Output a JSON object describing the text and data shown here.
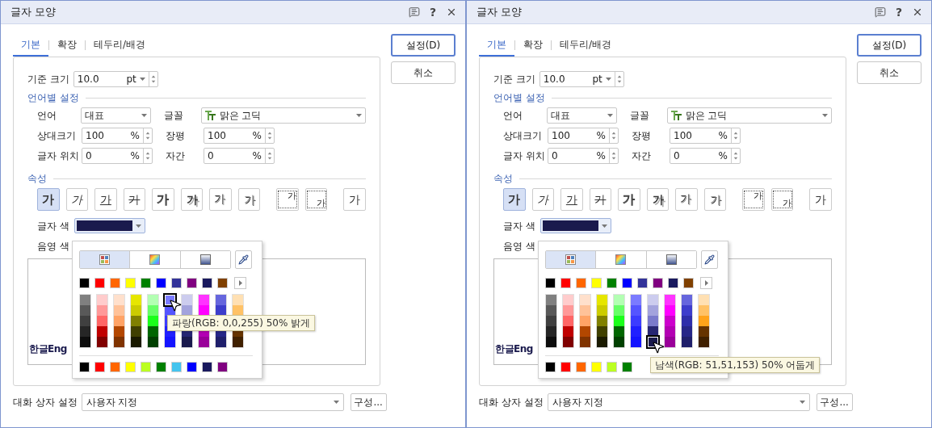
{
  "dialogs": [
    {
      "title": "글자 모양",
      "help": "?",
      "tabs": [
        {
          "label": "기본",
          "selected": true
        },
        {
          "label": "확장",
          "selected": false
        },
        {
          "label": "테두리/배경",
          "selected": false
        }
      ],
      "buttons": [
        {
          "label": "설정(D)",
          "default": true
        },
        {
          "label": "취소",
          "default": false
        }
      ],
      "base_size": {
        "label": "기준 크기",
        "value": "10.0",
        "unit": "pt"
      },
      "language_section": "언어별 설정",
      "language": {
        "label": "언어",
        "value": "대표"
      },
      "font": {
        "label": "글꼴",
        "value": "맑은 고딕"
      },
      "percent_fields": [
        {
          "label": "상대크기",
          "value": "100",
          "unit": "%"
        },
        {
          "label": "장평",
          "value": "100",
          "unit": "%"
        },
        {
          "label": "글자 위치",
          "value": "0",
          "unit": "%"
        },
        {
          "label": "자간",
          "value": "0",
          "unit": "%"
        }
      ],
      "attributes_section": "속성",
      "attributes": [
        {
          "kind": "bold",
          "label": "가",
          "selected": true
        },
        {
          "kind": "italic",
          "label": "가",
          "selected": false
        },
        {
          "kind": "underline",
          "label": "가",
          "selected": false
        },
        {
          "kind": "strike",
          "label": "가",
          "selected": false
        },
        {
          "kind": "outline",
          "label": "가",
          "selected": false
        },
        {
          "kind": "shadow",
          "label": "가",
          "selected": false
        },
        {
          "kind": "emboss",
          "label": "가",
          "selected": false
        },
        {
          "kind": "engrave",
          "label": "가",
          "selected": false
        },
        {
          "kind": "superscript",
          "label": "가",
          "selected": false
        },
        {
          "kind": "subscript",
          "label": "가",
          "selected": false
        },
        {
          "kind": "normal",
          "label": "가",
          "selected": false
        }
      ],
      "text_color": {
        "label": "글자 색",
        "color": "#1a1a4d"
      },
      "shade_color_label": "음영 색",
      "preview": "한글Eng",
      "picker": {
        "tabs": [
          {
            "kind": "palette",
            "selected": true
          },
          {
            "kind": "spectrum",
            "selected": false
          },
          {
            "kind": "gradient",
            "selected": false
          }
        ],
        "top_row": [
          {
            "color": "#000000"
          },
          {
            "color": "#ff0000"
          },
          {
            "color": "#ff6600"
          },
          {
            "color": "#ffff00"
          },
          {
            "color": "#008000"
          },
          {
            "color": "#0000ff"
          },
          {
            "color": "#333399"
          },
          {
            "color": "#800080"
          },
          {
            "color": "#1a1a5e"
          },
          {
            "color": "#804000"
          }
        ],
        "columns": [
          {
            "shades": [
              {
                "color": "#808080",
                "hovered": false
              },
              {
                "color": "#595959",
                "hovered": false
              },
              {
                "color": "#404040",
                "hovered": false
              },
              {
                "color": "#262626",
                "hovered": false
              },
              {
                "color": "#0d0d0d",
                "hovered": false
              }
            ]
          },
          {
            "shades": [
              {
                "color": "#ffcccc",
                "hovered": false
              },
              {
                "color": "#ff9999",
                "hovered": false
              },
              {
                "color": "#ff6666",
                "hovered": false
              },
              {
                "color": "#c00000",
                "hovered": false
              },
              {
                "color": "#800000",
                "hovered": false
              }
            ]
          },
          {
            "shades": [
              {
                "color": "#ffe0cc",
                "hovered": false
              },
              {
                "color": "#ffc299",
                "hovered": false
              },
              {
                "color": "#ffa366",
                "hovered": false
              },
              {
                "color": "#b34700",
                "hovered": false
              },
              {
                "color": "#803300",
                "hovered": false
              }
            ]
          },
          {
            "shades": [
              {
                "color": "#e6e600",
                "hovered": false
              },
              {
                "color": "#cccc00",
                "hovered": false
              },
              {
                "color": "#808000",
                "hovered": false
              },
              {
                "color": "#404000",
                "hovered": false
              },
              {
                "color": "#1a1a00",
                "hovered": false
              }
            ]
          },
          {
            "shades": [
              {
                "color": "#b3ffb3",
                "hovered": false
              },
              {
                "color": "#66ff66",
                "hovered": false
              },
              {
                "color": "#1aff1a",
                "hovered": false
              },
              {
                "color": "#006600",
                "hovered": false
              },
              {
                "color": "#004000",
                "hovered": false
              }
            ]
          },
          {
            "shades": [
              {
                "color": "#7b7bff",
                "hovered": true
              },
              {
                "color": "#5555ff",
                "hovered": false
              },
              {
                "color": "#3c3cff",
                "hovered": false
              },
              {
                "color": "#2020ff",
                "hovered": false
              },
              {
                "color": "#1414ff",
                "hovered": false
              }
            ]
          },
          {
            "shades": [
              {
                "color": "#ccccee",
                "hovered": false
              },
              {
                "color": "#a3a3dd",
                "hovered": false
              }
            ],
            "shades_below": [
              {
                "color": "#262673",
                "hovered": false
              },
              {
                "color": "#1a1a4d",
                "hovered": false
              }
            ]
          },
          {
            "shades": [
              {
                "color": "#ff33ff",
                "hovered": false
              },
              {
                "color": "#ff00ff",
                "hovered": false
              }
            ],
            "shades_below": [
              {
                "color": "#b300b3",
                "hovered": false
              },
              {
                "color": "#990099",
                "hovered": false
              }
            ]
          },
          {
            "shades": [
              {
                "color": "#6666dd",
                "hovered": false
              },
              {
                "color": "#3d3dcc",
                "hovered": false
              }
            ],
            "shades_below": [
              {
                "color": "#262688",
                "hovered": false
              },
              {
                "color": "#1f1f6b",
                "hovered": false
              }
            ]
          },
          {
            "shades": [
              {
                "color": "#ffe0b3",
                "hovered": false
              },
              {
                "color": "#ffc266",
                "hovered": false
              }
            ],
            "shades_below": [
              {
                "color": "#663300",
                "hovered": false
              },
              {
                "color": "#402000",
                "hovered": false
              }
            ]
          }
        ],
        "recent": [
          {
            "color": "#000000"
          },
          {
            "color": "#ff0000"
          },
          {
            "color": "#ff6600"
          },
          {
            "color": "#ffff00"
          },
          {
            "color": "#bbff22"
          },
          {
            "color": "#008000"
          },
          {
            "color": "#44c4ee"
          },
          {
            "color": "#0000ff"
          },
          {
            "color": "#1a1a5e"
          },
          {
            "color": "#800080"
          }
        ],
        "tooltip": "파랑(RGB: 0,0,255) 50% 밝게"
      },
      "dialog_setting": {
        "label": "대화 상자 설정",
        "value": "사용자 지정"
      },
      "compose_button": "구성..."
    },
    {
      "title": "글자 모양",
      "help": "?",
      "tabs": [
        {
          "label": "기본",
          "selected": true
        },
        {
          "label": "확장",
          "selected": false
        },
        {
          "label": "테두리/배경",
          "selected": false
        }
      ],
      "buttons": [
        {
          "label": "설정(D)",
          "default": true
        },
        {
          "label": "취소",
          "default": false
        }
      ],
      "base_size": {
        "label": "기준 크기",
        "value": "10.0",
        "unit": "pt"
      },
      "language_section": "언어별 설정",
      "language": {
        "label": "언어",
        "value": "대표"
      },
      "font": {
        "label": "글꼴",
        "value": "맑은 고딕"
      },
      "percent_fields": [
        {
          "label": "상대크기",
          "value": "100",
          "unit": "%"
        },
        {
          "label": "장평",
          "value": "100",
          "unit": "%"
        },
        {
          "label": "글자 위치",
          "value": "0",
          "unit": "%"
        },
        {
          "label": "자간",
          "value": "0",
          "unit": "%"
        }
      ],
      "attributes_section": "속성",
      "attributes": [
        {
          "kind": "bold",
          "label": "가",
          "selected": true
        },
        {
          "kind": "italic",
          "label": "가",
          "selected": false
        },
        {
          "kind": "underline",
          "label": "가",
          "selected": false
        },
        {
          "kind": "strike",
          "label": "가",
          "selected": false
        },
        {
          "kind": "outline",
          "label": "가",
          "selected": false
        },
        {
          "kind": "shadow",
          "label": "가",
          "selected": false
        },
        {
          "kind": "emboss",
          "label": "가",
          "selected": false
        },
        {
          "kind": "engrave",
          "label": "가",
          "selected": false
        },
        {
          "kind": "superscript",
          "label": "가",
          "selected": false
        },
        {
          "kind": "subscript",
          "label": "가",
          "selected": false
        },
        {
          "kind": "normal",
          "label": "가",
          "selected": false
        }
      ],
      "text_color": {
        "label": "글자 색",
        "color": "#1a1a4d"
      },
      "shade_color_label": "음영 색",
      "preview": "한글Eng",
      "picker": {
        "tabs": [
          {
            "kind": "palette",
            "selected": true
          },
          {
            "kind": "spectrum",
            "selected": false
          },
          {
            "kind": "gradient",
            "selected": false
          }
        ],
        "top_row": [
          {
            "color": "#000000"
          },
          {
            "color": "#ff0000"
          },
          {
            "color": "#ff6600"
          },
          {
            "color": "#ffff00"
          },
          {
            "color": "#008000"
          },
          {
            "color": "#0000ff"
          },
          {
            "color": "#333399"
          },
          {
            "color": "#800080"
          },
          {
            "color": "#1a1a5e"
          },
          {
            "color": "#804000"
          }
        ],
        "columns": [
          {
            "shades": [
              {
                "color": "#808080",
                "hovered": false
              },
              {
                "color": "#595959",
                "hovered": false
              },
              {
                "color": "#404040",
                "hovered": false
              },
              {
                "color": "#262626",
                "hovered": false
              },
              {
                "color": "#0d0d0d",
                "hovered": false
              }
            ]
          },
          {
            "shades": [
              {
                "color": "#ffcccc",
                "hovered": false
              },
              {
                "color": "#ff9999",
                "hovered": false
              },
              {
                "color": "#ff6666",
                "hovered": false
              },
              {
                "color": "#c00000",
                "hovered": false
              },
              {
                "color": "#800000",
                "hovered": false
              }
            ]
          },
          {
            "shades": [
              {
                "color": "#ffe0cc",
                "hovered": false
              },
              {
                "color": "#ffc299",
                "hovered": false
              },
              {
                "color": "#ffa366",
                "hovered": false
              },
              {
                "color": "#b34700",
                "hovered": false
              },
              {
                "color": "#803300",
                "hovered": false
              }
            ]
          },
          {
            "shades": [
              {
                "color": "#e6e600",
                "hovered": false
              },
              {
                "color": "#cccc00",
                "hovered": false
              },
              {
                "color": "#808000",
                "hovered": false
              },
              {
                "color": "#404000",
                "hovered": false
              },
              {
                "color": "#1a1a00",
                "hovered": false
              }
            ]
          },
          {
            "shades": [
              {
                "color": "#b3ffb3",
                "hovered": false
              },
              {
                "color": "#66ff66",
                "hovered": false
              },
              {
                "color": "#1aff1a",
                "hovered": false
              },
              {
                "color": "#006600",
                "hovered": false
              },
              {
                "color": "#004000",
                "hovered": false
              }
            ]
          },
          {
            "shades": [
              {
                "color": "#7b7bff",
                "hovered": false
              },
              {
                "color": "#5555ff",
                "hovered": false
              },
              {
                "color": "#3c3cff",
                "hovered": false
              },
              {
                "color": "#2020ff",
                "hovered": false
              },
              {
                "color": "#1414ff",
                "hovered": false
              }
            ]
          },
          {
            "shades": [
              {
                "color": "#ccccee",
                "hovered": false
              },
              {
                "color": "#a3a3dd",
                "hovered": false
              },
              {
                "color": "#7a7acc",
                "hovered": false
              },
              {
                "color": "#262673",
                "hovered": false
              },
              {
                "color": "#1a1a4d",
                "hovered": true
              }
            ]
          },
          {
            "shades": [
              {
                "color": "#ff33ff",
                "hovered": false
              },
              {
                "color": "#ff00ff",
                "hovered": false
              },
              {
                "color": "#cc00cc",
                "hovered": false
              },
              {
                "color": "#b300b3",
                "hovered": false
              },
              {
                "color": "#990099",
                "hovered": false
              }
            ]
          },
          {
            "shades": [
              {
                "color": "#6666dd",
                "hovered": false
              },
              {
                "color": "#3d3dcc",
                "hovered": false
              },
              {
                "color": "#2e2eaa",
                "hovered": false
              },
              {
                "color": "#262688",
                "hovered": false
              },
              {
                "color": "#1f1f6b",
                "hovered": false
              }
            ]
          },
          {
            "shades": [
              {
                "color": "#ffe0b3",
                "hovered": false
              },
              {
                "color": "#ffc266",
                "hovered": false
              },
              {
                "color": "#ffa31a",
                "hovered": false
              },
              {
                "color": "#663300",
                "hovered": false
              },
              {
                "color": "#402000",
                "hovered": false
              }
            ]
          }
        ],
        "recent": [
          {
            "color": "#000000"
          },
          {
            "color": "#ff0000"
          },
          {
            "color": "#ff6600"
          },
          {
            "color": "#ffff00"
          },
          {
            "color": "#bbff22"
          },
          {
            "color": "#008000"
          }
        ],
        "tooltip": "남색(RGB: 51,51,153) 50% 어둡게"
      },
      "dialog_setting": {
        "label": "대화 상자 설정",
        "value": "사용자 지정"
      },
      "compose_button": "구성..."
    }
  ]
}
